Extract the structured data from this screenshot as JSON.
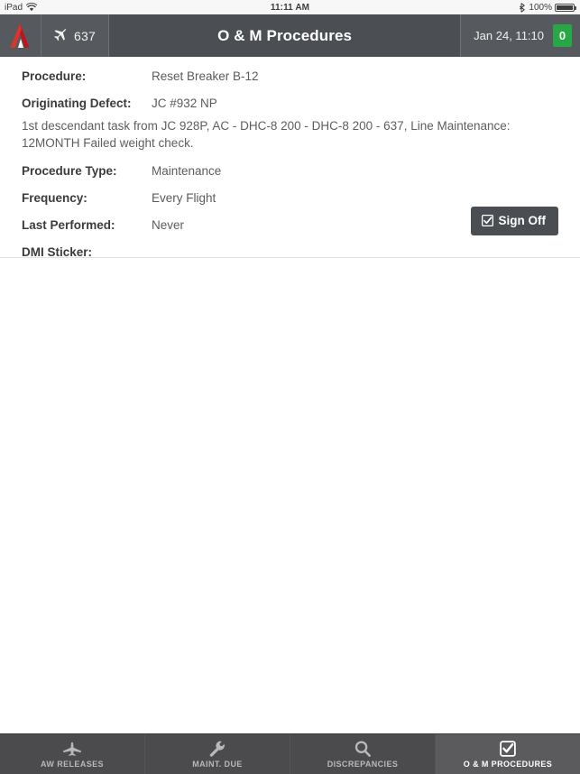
{
  "status_bar": {
    "device_label": "iPad",
    "wifi_icon": "wifi-icon",
    "time": "11:11 AM",
    "bluetooth_icon": "bluetooth-icon",
    "battery_percent": "100%",
    "battery_icon": "battery-full-icon"
  },
  "nav": {
    "logo_icon": "app-logo-icon",
    "plane_icon": "airplane-icon",
    "tail_number": "637",
    "title": "O & M Procedures",
    "date_time": "Jan 24, 11:10",
    "badge_count": "0",
    "badge_color": "#27a745"
  },
  "detail": {
    "rows": [
      {
        "label": "Procedure:",
        "value": "Reset Breaker B-12"
      },
      {
        "label": "Originating Defect:",
        "value": "JC #932 NP"
      },
      {
        "label": "Procedure Type:",
        "value": "Maintenance"
      },
      {
        "label": "Frequency:",
        "value": "Every Flight"
      },
      {
        "label": "Last Performed:",
        "value": "Never"
      },
      {
        "label": "DMI Sticker:",
        "value": ""
      }
    ],
    "defect_description": "1st descendant task from JC 928P, AC - DHC-8 200 - DHC-8 200 - 637, Line Maintenance: 12MONTH Failed weight check.",
    "sign_off_button": {
      "label": "Sign Off",
      "icon": "check-box-icon",
      "color": "#4a4e53"
    }
  },
  "tab_bar": {
    "tabs": [
      {
        "label": "AW RELEASES",
        "icon": "airplane-icon",
        "active": false
      },
      {
        "label": "MAINT. DUE",
        "icon": "wrench-icon",
        "active": false
      },
      {
        "label": "DISCREPANCIES",
        "icon": "magnifier-icon",
        "active": false
      },
      {
        "label": "O & M PROCEDURES",
        "icon": "check-box-icon",
        "active": true
      }
    ]
  }
}
